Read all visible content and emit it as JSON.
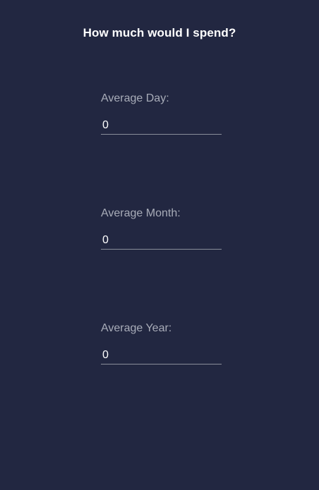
{
  "header": {
    "title": "How much would I spend?"
  },
  "fields": [
    {
      "label": "Average Day:",
      "value": "0"
    },
    {
      "label": "Average Month:",
      "value": "0"
    },
    {
      "label": "Average Year:",
      "value": "0"
    }
  ],
  "colors": {
    "background": "#222741",
    "title_text": "#ffffff",
    "label_text": "#a8acb8",
    "value_text": "#ffffff",
    "underline": "#8a8e9a"
  }
}
